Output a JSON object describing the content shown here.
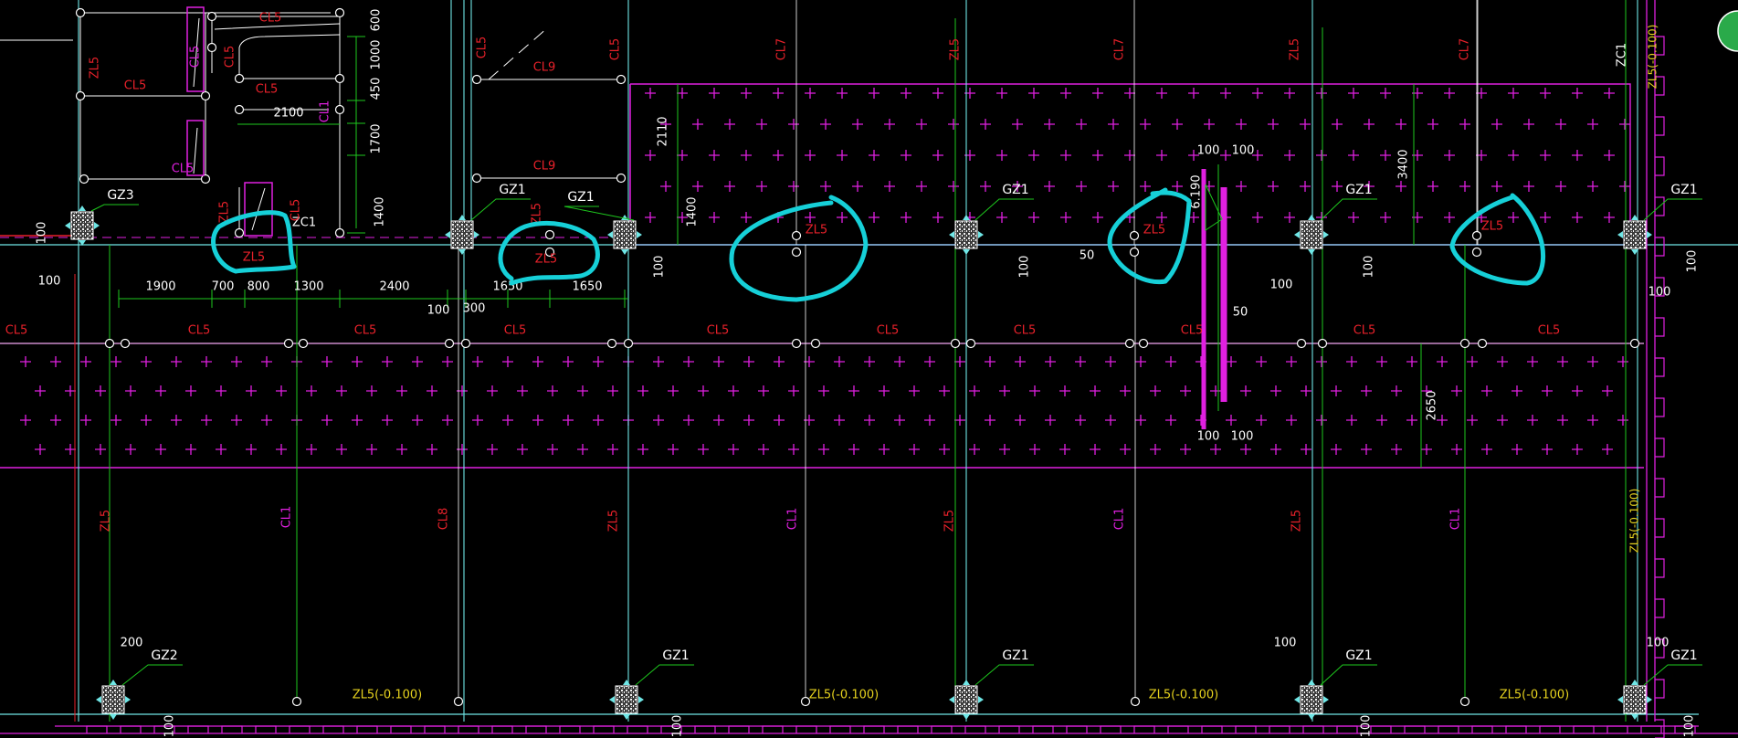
{
  "drawing": {
    "background": "#000000",
    "colors": {
      "beam_label": "#e8212a",
      "column_label": "#ffffff",
      "slab_boundary": "#e020e0",
      "slab_cross": "#e020e0",
      "dimension": "#ffffff",
      "dimension_line": "#1ec81e",
      "grid_line": "#6fe6e6",
      "ref_line": "#ffffff",
      "magenta_label": "#e020e0",
      "elevation_label": "#e6d21e",
      "markup": "#16d0d8",
      "column_fill": "#dcdcdc"
    },
    "column_tags": {
      "gz1": "GZ1",
      "gz2": "GZ2",
      "gz3": "GZ3",
      "zc1": "ZC1"
    },
    "beam_tags": {
      "zl5": "ZL5",
      "zl5_elev": "ZL5(-0.100)",
      "cl5": "CL5",
      "cl1": "CL1",
      "cl7": "CL7",
      "cl8": "CL8",
      "cl9": "CL9",
      "zc1": "ZC1"
    },
    "dimensions": {
      "d1900": "1900",
      "d700": "700",
      "d800": "800",
      "d1300": "1300",
      "d2400": "2400",
      "d100": "100",
      "d300": "300",
      "d1650": "1650",
      "d2100": "2100",
      "d600": "600",
      "d1000": "1000",
      "d450": "450",
      "d1700": "1700",
      "d1400": "1400",
      "d2110": "2110",
      "d3400": "3400",
      "d2650": "2650",
      "d200": "200",
      "d50": "50",
      "d6190": "6.190"
    }
  }
}
